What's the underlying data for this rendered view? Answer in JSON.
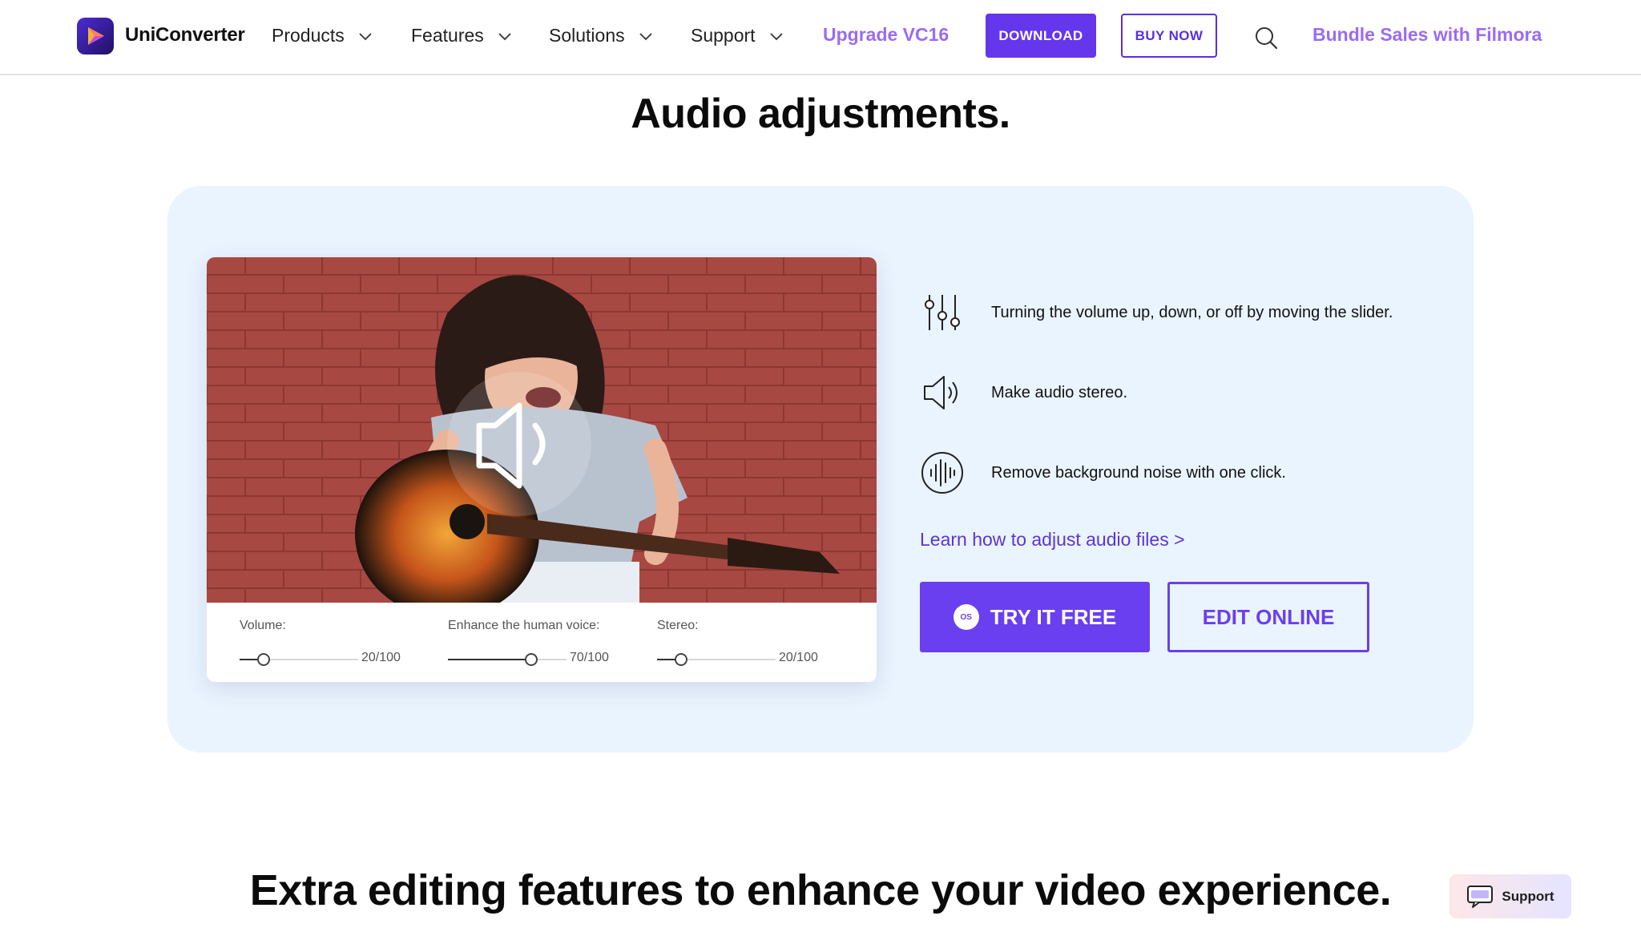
{
  "header": {
    "brand": "UniConverter",
    "nav": [
      {
        "label": "Products"
      },
      {
        "label": "Features"
      },
      {
        "label": "Solutions"
      },
      {
        "label": "Support"
      }
    ],
    "upgrade": "Upgrade VC16",
    "download": "DOWNLOAD",
    "buy_now": "BUY NOW",
    "bundle": "Bundle Sales with Filmora"
  },
  "section": {
    "title": "Audio adjustments.",
    "sliders": [
      {
        "label": "Volume:",
        "value_text": "20/100",
        "fraction": 0.2
      },
      {
        "label": "Enhance the human voice:",
        "value_text": "70/100",
        "fraction": 0.7
      },
      {
        "label": "Stereo:",
        "value_text": "20/100",
        "fraction": 0.2
      }
    ],
    "features": [
      {
        "icon": "equalizer-sliders-icon",
        "text": "Turning the volume up, down, or off by moving the slider."
      },
      {
        "icon": "speaker-stereo-icon",
        "text": "Make audio stereo."
      },
      {
        "icon": "sound-wave-icon",
        "text": "Remove background noise with one click."
      }
    ],
    "learn_link": "Learn how to adjust audio files >",
    "try_free": "TRY IT FREE",
    "os_badge": "OS",
    "edit_online": "EDIT ONLINE"
  },
  "next_section": {
    "title": "Extra editing features to enhance your video experience."
  },
  "support_widget": {
    "label": "Support"
  },
  "colors": {
    "accent": "#6a3ff0",
    "accent_light": "#9a6cf0",
    "panel_bg": "#eaf4ff",
    "brick": "#a84842"
  }
}
